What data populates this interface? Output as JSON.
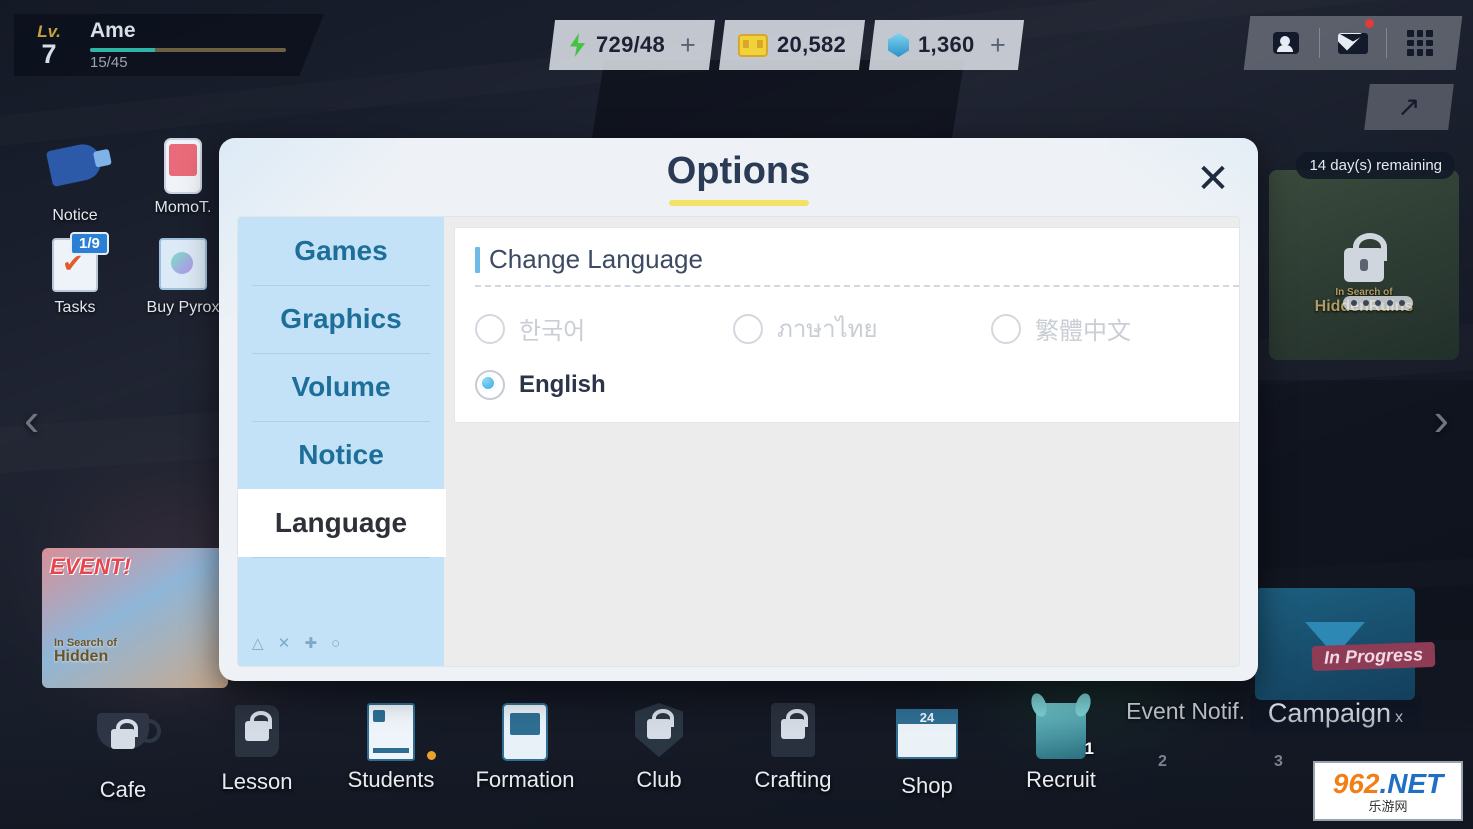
{
  "player": {
    "lv_label": "Lv.",
    "level": "7",
    "name": "Ame",
    "exp": "15/45"
  },
  "resources": [
    {
      "icon": "bolt-icon",
      "value": "729/48",
      "plus": "+"
    },
    {
      "icon": "credit-icon",
      "value": "20,582",
      "plus": ""
    },
    {
      "icon": "gem-icon",
      "value": "1,360",
      "plus": "+"
    }
  ],
  "topright": {
    "friends": "friends-icon",
    "mail": "mail-icon",
    "menu": "menu-grid-icon",
    "expand": "↗"
  },
  "left_menu": [
    {
      "label": "Notice",
      "icon": "megaphone-icon",
      "badge": ""
    },
    {
      "label": "MomoT.",
      "icon": "phone-icon",
      "badge": ""
    },
    {
      "label": "Tasks",
      "icon": "clipboard-icon",
      "badge": "1/9"
    },
    {
      "label": "Buy Pyrox",
      "icon": "pyrox-bag-icon",
      "badge": ""
    }
  ],
  "event_banner": {
    "tag": "EVENT!",
    "title": "Hidden",
    "subtitle": "In Search of"
  },
  "right_banner": {
    "days_remaining": "14 day(s) remaining",
    "subtitle": "In Search of",
    "title": "HiddenRuins",
    "dots": 5
  },
  "campaign": {
    "label": "Campaign",
    "badge": "In Progress",
    "suffix": "x"
  },
  "event_notif": "Event Notif.",
  "nav_arrows": {
    "left": "‹",
    "right": "›"
  },
  "page_numbers": [
    "2",
    "3"
  ],
  "bottom_nav": [
    {
      "label": "Cafe",
      "icon": "cafe-icon",
      "locked": true,
      "badge": ""
    },
    {
      "label": "Lesson",
      "icon": "lesson-icon",
      "locked": true,
      "badge": ""
    },
    {
      "label": "Students",
      "icon": "students-icon",
      "locked": false,
      "badge": ""
    },
    {
      "label": "Formation",
      "icon": "formation-icon",
      "locked": false,
      "badge": ""
    },
    {
      "label": "Club",
      "icon": "club-icon",
      "locked": true,
      "badge": ""
    },
    {
      "label": "Crafting",
      "icon": "crafting-icon",
      "locked": true,
      "badge": ""
    },
    {
      "label": "Shop",
      "icon": "shop-icon",
      "locked": false,
      "badge": "",
      "shop_num": "24"
    },
    {
      "label": "Recruit",
      "icon": "recruit-icon",
      "locked": false,
      "badge": "1"
    }
  ],
  "watermark": {
    "line1a": "962",
    "line1b": ".NET",
    "line2": "乐游网"
  },
  "dialog": {
    "title": "Options",
    "close": "✕",
    "tabs": [
      {
        "label": "Games",
        "active": false
      },
      {
        "label": "Graphics",
        "active": false
      },
      {
        "label": "Volume",
        "active": false
      },
      {
        "label": "Notice",
        "active": false
      },
      {
        "label": "Language",
        "active": true
      }
    ],
    "glyph_row": "△ ✕ ✚ ○",
    "section_title": "Change Language",
    "languages": [
      {
        "label": "한국어",
        "selected": false
      },
      {
        "label": "ภาษาไทย",
        "selected": false
      },
      {
        "label": "繁體中文",
        "selected": false
      },
      {
        "label": "English",
        "selected": true
      }
    ]
  },
  "colors": {
    "accent_blue": "#6fbbe8",
    "tab_blue": "#c3e2f7",
    "title_navy": "#2b3a55",
    "underline_yellow": "#f2e364"
  }
}
